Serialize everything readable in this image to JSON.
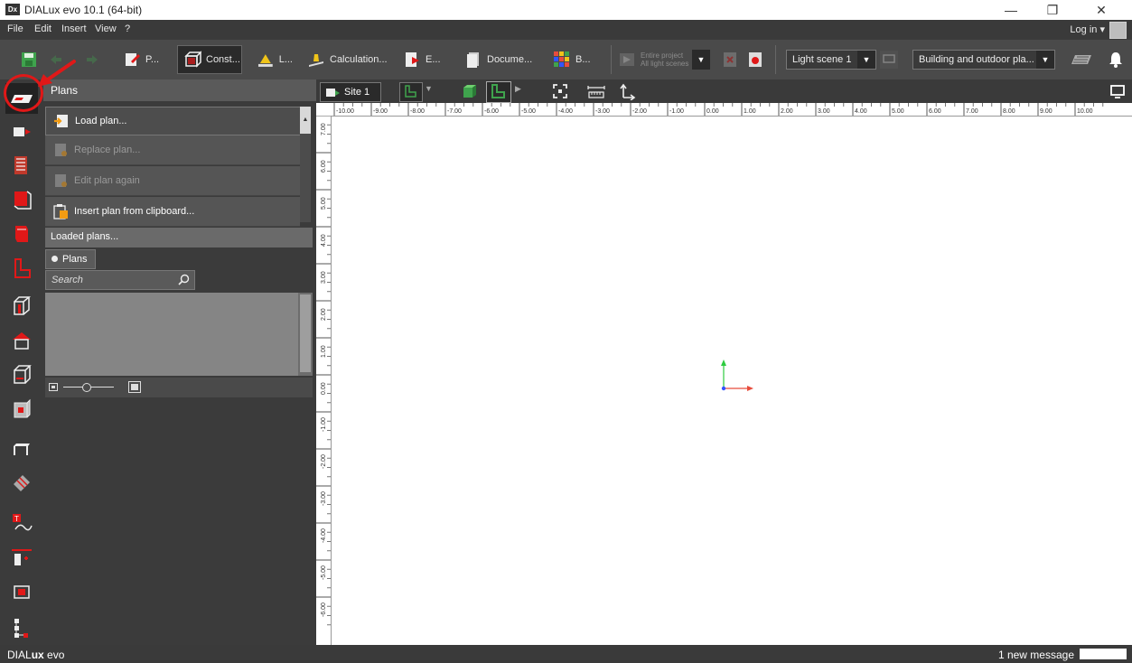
{
  "window": {
    "title": "DIALux evo 10.1  (64-bit)",
    "logo": "Dx",
    "minimize": "—",
    "restore": "❐",
    "close": "✕"
  },
  "menu": {
    "items": [
      "File",
      "Edit",
      "Insert",
      "View",
      "?"
    ],
    "login": "Log in"
  },
  "toolbar": {
    "save_icon": "save-icon",
    "tabs": [
      {
        "label": "P...",
        "icon": "project-icon"
      },
      {
        "label": "Const...",
        "icon": "construction-icon",
        "active": true
      },
      {
        "label": "L...",
        "icon": "light-icon"
      },
      {
        "label": "Calculation...",
        "icon": "calculation-icon"
      },
      {
        "label": "E...",
        "icon": "export-icon"
      },
      {
        "label": "Docume...",
        "icon": "document-icon"
      },
      {
        "label": "B...",
        "icon": "bim-icon"
      }
    ],
    "scope_line1": "Entire project",
    "scope_line2": "All light scenes",
    "light_scene": "Light scene 1",
    "view_mode": "Building and outdoor pla..."
  },
  "panel": {
    "title": "Plans",
    "actions": [
      {
        "label": "Load plan...",
        "enabled": true
      },
      {
        "label": "Replace plan...",
        "enabled": false
      },
      {
        "label": "Edit plan again",
        "enabled": false
      },
      {
        "label": "Insert plan from clipboard...",
        "enabled": true
      }
    ],
    "loaded_plans": "Loaded plans...",
    "tab": "Plans",
    "search_placeholder": "Search"
  },
  "canvas_toolbar": {
    "site": "Site 1"
  },
  "ruler": {
    "top": [
      "-10.00",
      "-9.00",
      "-8.00",
      "-7.00",
      "-6.00",
      "-5.00",
      "-4.00",
      "-3.00",
      "-2.00",
      "-1.00",
      "0.00",
      "1.00",
      "2.00",
      "3.00",
      "4.00",
      "5.00",
      "6.00",
      "7.00",
      "8.00",
      "9.00",
      "10.00"
    ],
    "left": [
      "7.00",
      "6.00",
      "5.00",
      "4.00",
      "3.00",
      "2.00",
      "1.00",
      "0.00",
      "-1.00",
      "-2.00",
      "-3.00",
      "-4.00",
      "-5.00",
      "-6.00"
    ]
  },
  "status": {
    "brand_a": "DIAL",
    "brand_b": "ux",
    "brand_c": " evo",
    "message": "1 new message"
  },
  "colors": {
    "accent_red": "#e01818",
    "axis_green": "#2ecc40",
    "axis_red": "#e74c3c",
    "axis_blue": "#3355ff"
  }
}
